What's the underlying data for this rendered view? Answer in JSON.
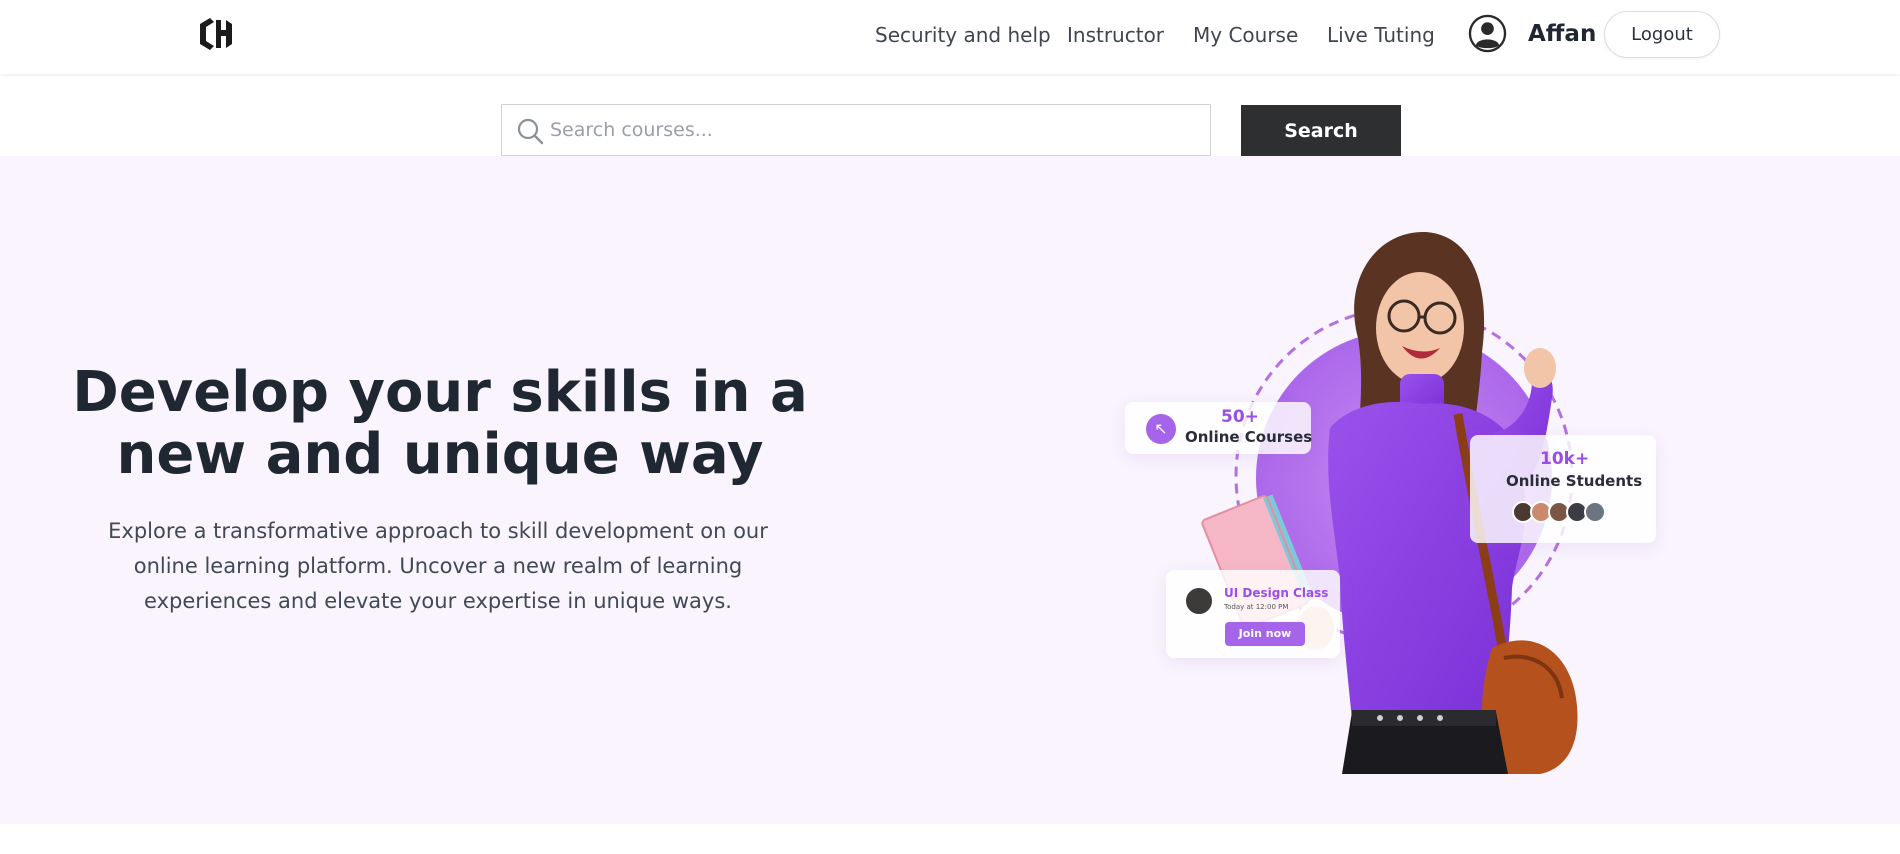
{
  "header": {
    "logo_text": "CH",
    "nav": [
      "Security and help",
      "Instructor",
      "My Course",
      "Live Tuting"
    ],
    "user_name": "Affan",
    "logout_label": "Logout"
  },
  "search": {
    "placeholder": "Search courses...",
    "button_label": "Search"
  },
  "hero": {
    "title": "Develop your skills in a new and unique way",
    "description": "Explore a transformative approach to skill development on our online learning platform. Uncover a new realm of learning experiences and elevate your expertise in unique ways.",
    "illustration": {
      "courses_count": "50+",
      "courses_label": "Online Courses",
      "students_count": "10k+",
      "students_label": "Online Students",
      "class_title": "UI Design Class",
      "class_time": "Today at 12:00 PM",
      "join_label": "Join now"
    }
  },
  "colors": {
    "accent_purple": "#9b4de6",
    "hero_bg": "#f9f4fd",
    "search_button": "#2d2f31"
  }
}
